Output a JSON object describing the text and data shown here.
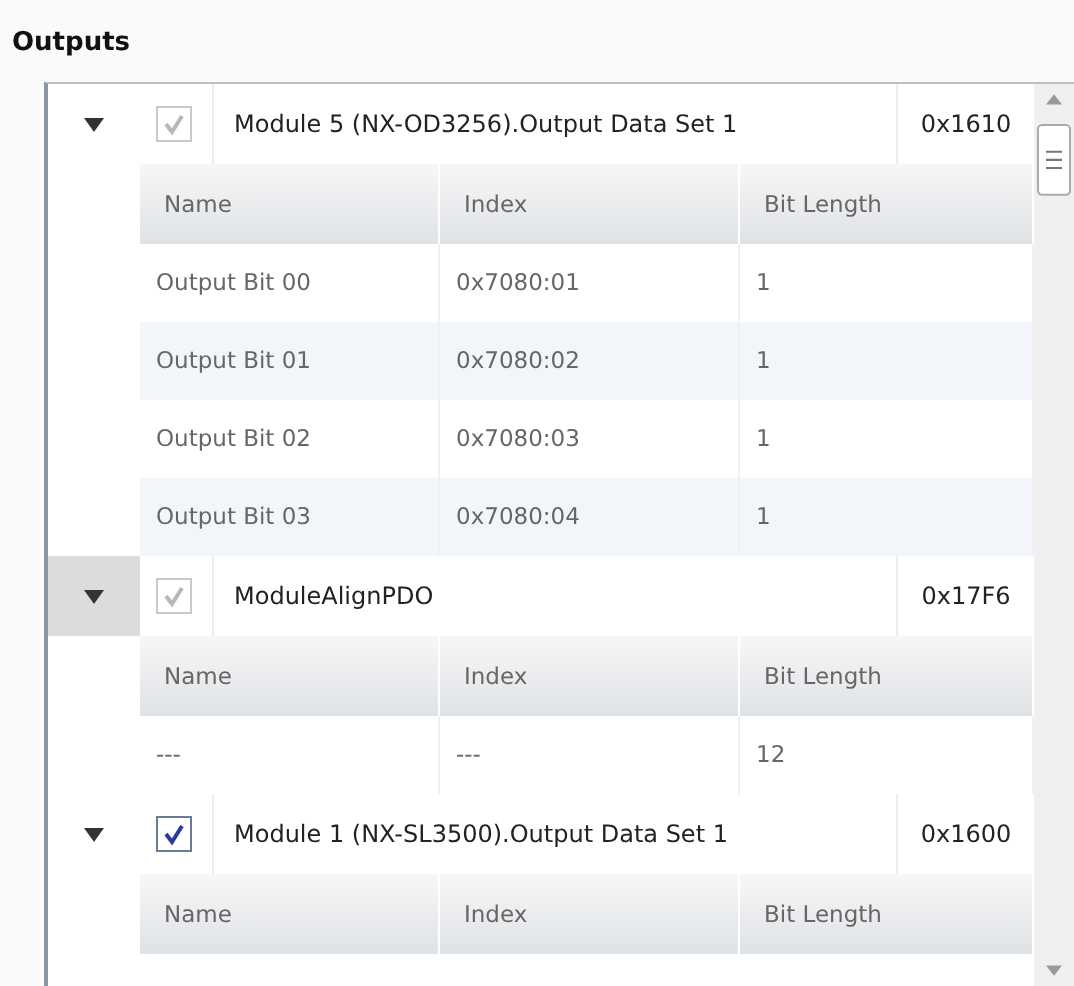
{
  "title": "Outputs",
  "groups": [
    {
      "name": "Module 5 (NX-OD3256).Output Data Set 1",
      "index": "0x1610",
      "expanded": true,
      "checked": true,
      "disabled": true,
      "selected": false,
      "columns": [
        "Name",
        "Index",
        "Bit Length"
      ],
      "rows": [
        [
          "Output Bit 00",
          "0x7080:01",
          "1"
        ],
        [
          "Output Bit 01",
          "0x7080:02",
          "1"
        ],
        [
          "Output Bit 02",
          "0x7080:03",
          "1"
        ],
        [
          "Output Bit 03",
          "0x7080:04",
          "1"
        ]
      ]
    },
    {
      "name": "ModuleAlignPDO",
      "index": "0x17F6",
      "expanded": true,
      "checked": true,
      "disabled": true,
      "selected": true,
      "columns": [
        "Name",
        "Index",
        "Bit Length"
      ],
      "rows": [
        [
          "---",
          "---",
          "12"
        ]
      ]
    },
    {
      "name": "Module 1 (NX-SL3500).Output Data Set 1",
      "index": "0x1600",
      "expanded": true,
      "checked": true,
      "disabled": false,
      "selected": false,
      "columns": [
        "Name",
        "Index",
        "Bit Length"
      ]
    }
  ]
}
